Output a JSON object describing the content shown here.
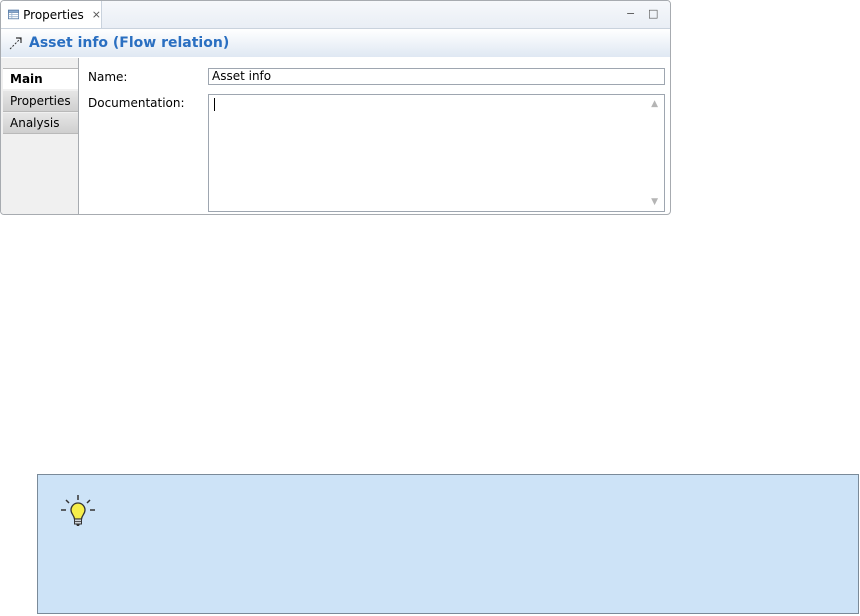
{
  "view_tab": {
    "label": "Properties",
    "close_glyph": "⨯",
    "icon": "properties-table-icon"
  },
  "window_controls": {
    "minimize_glyph": "−",
    "maximize_glyph": "□"
  },
  "header": {
    "title": "Asset info (Flow relation)",
    "icon": "flow-relation-icon",
    "title_color": "#2a6fc1"
  },
  "sidebar": {
    "items": [
      {
        "label": "Main",
        "active": true
      },
      {
        "label": "Properties",
        "active": false
      },
      {
        "label": "Analysis",
        "active": false
      }
    ]
  },
  "form": {
    "name_label": "Name:",
    "name_value": "Asset info",
    "documentation_label": "Documentation:",
    "documentation_value": ""
  },
  "tip": {
    "icon": "lightbulb-icon",
    "background": "#cde3f7"
  }
}
